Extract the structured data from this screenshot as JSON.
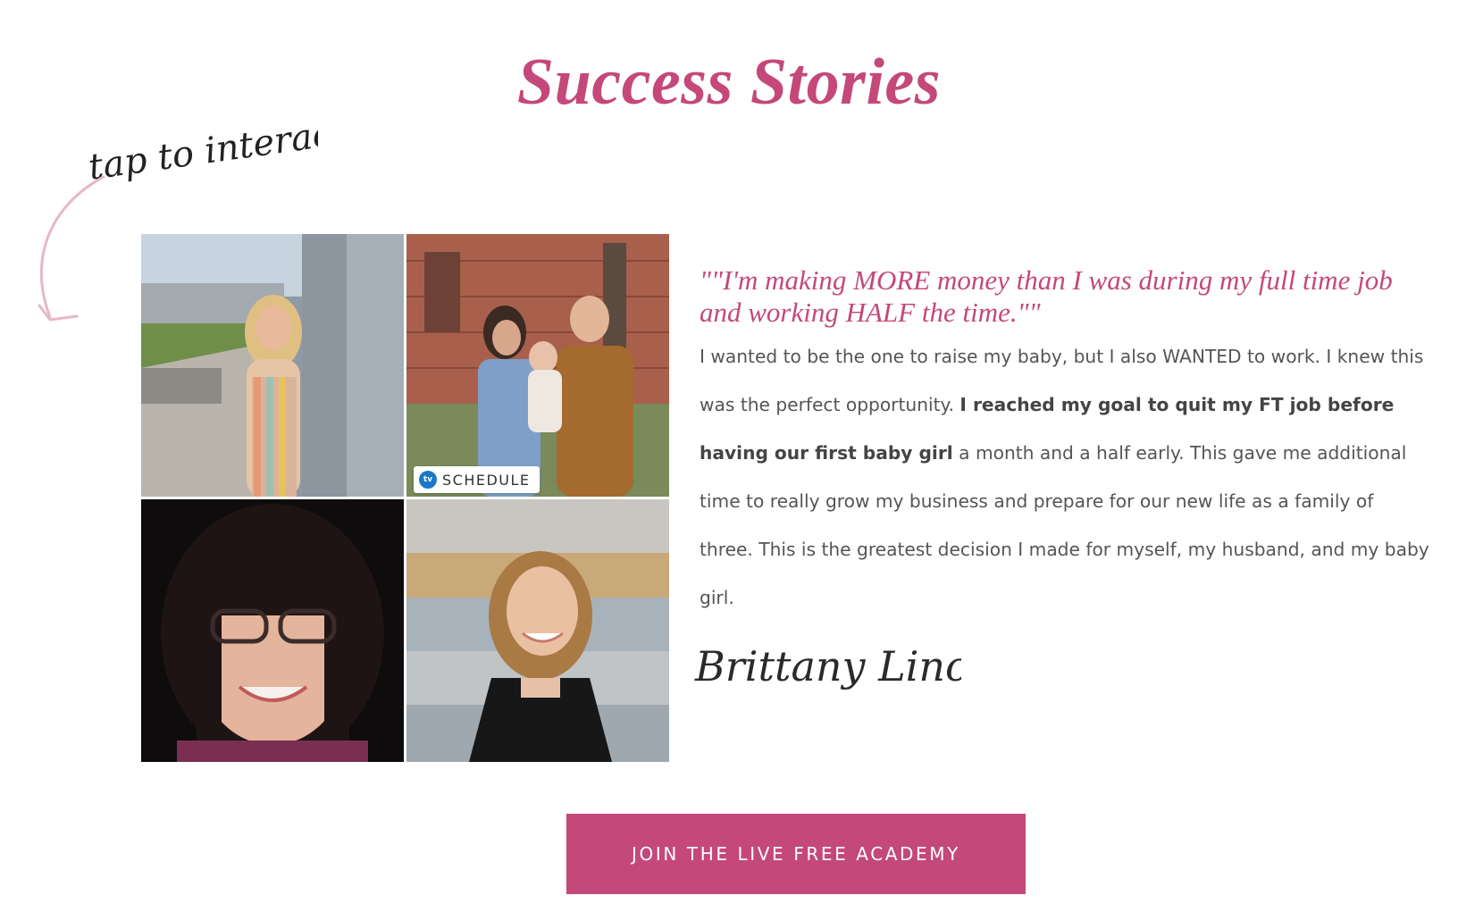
{
  "section": {
    "title": "Success Stories",
    "tap_note": "tap to interact!"
  },
  "gallery": {
    "photos": [
      {
        "name": "woman-striped-dress"
      },
      {
        "name": "family-portrait",
        "badge": "SCHEDULE",
        "badge_icon": "tv"
      },
      {
        "name": "woman-dark-bangs-glasses"
      },
      {
        "name": "woman-smiling-blonde"
      }
    ]
  },
  "testimonial": {
    "quote": "\"\"I'm making MORE money than I was during my full time job and working HALF the time.\"\"",
    "body_part1": "I wanted to be the one to raise my baby, but I also WANTED to work. I knew this was the perfect opportunity. ",
    "body_bold": "I reached my goal to quit my FT job before having our first baby girl",
    "body_part2": " a month and a half early. This gave me additional time to really grow my business and prepare for our new life as a family of three. This is the greatest decision I made for myself, my husband, and my baby girl.",
    "signature": "Brittany Lincks"
  },
  "cta": {
    "label": "JOIN THE LIVE FREE ACADEMY"
  },
  "colors": {
    "accent": "#c4487a",
    "body_text": "#555555",
    "badge_icon": "#1b78c8"
  }
}
